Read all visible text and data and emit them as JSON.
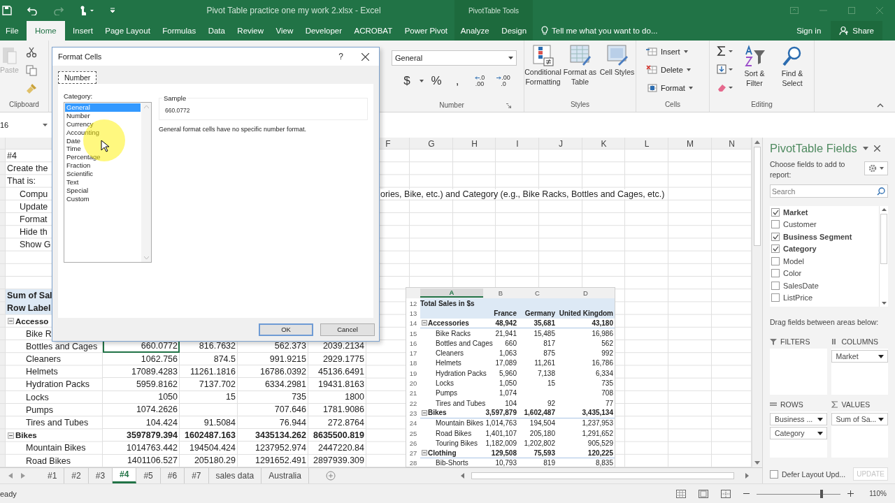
{
  "window": {
    "title": "Pivot Table practice one my work 2.xlsx - Excel",
    "context_group": "PivotTable Tools"
  },
  "ribbon_tabs": [
    {
      "label": "File",
      "selected": false,
      "contextual": false
    },
    {
      "label": "Home",
      "selected": true,
      "contextual": false
    },
    {
      "label": "Insert",
      "selected": false,
      "contextual": false
    },
    {
      "label": "Page Layout",
      "selected": false,
      "contextual": false
    },
    {
      "label": "Formulas",
      "selected": false,
      "contextual": false
    },
    {
      "label": "Data",
      "selected": false,
      "contextual": false
    },
    {
      "label": "Review",
      "selected": false,
      "contextual": false
    },
    {
      "label": "View",
      "selected": false,
      "contextual": false
    },
    {
      "label": "Developer",
      "selected": false,
      "contextual": false
    },
    {
      "label": "ACROBAT",
      "selected": false,
      "contextual": false
    },
    {
      "label": "Power Pivot",
      "selected": false,
      "contextual": false
    },
    {
      "label": "Analyze",
      "selected": false,
      "contextual": true
    },
    {
      "label": "Design",
      "selected": false,
      "contextual": true
    }
  ],
  "tell_me": "Tell me what you want to do...",
  "sign_in": "Sign in",
  "share": "Share",
  "ribbon": {
    "clipboard": {
      "paste": {
        "label": "Paste",
        "disabled": true
      },
      "label": "Clipboard"
    },
    "number": {
      "format": "General",
      "symbols": [
        "$",
        "%",
        ","
      ],
      "decimals": [
        {
          "top": ".0",
          "bottom": ".00"
        },
        {
          "top": ".00",
          "bottom": ".0"
        }
      ],
      "label": "Number"
    },
    "styles": {
      "buttons": [
        "Conditional Formatting",
        "Format as Table",
        "Cell Styles"
      ],
      "label": "Styles"
    },
    "cells": {
      "buttons": [
        "Insert",
        "Delete",
        "Format"
      ],
      "label": "Cells"
    },
    "editing": {
      "buttons": [
        "Sort & Filter",
        "Find & Select"
      ],
      "label": "Editing"
    }
  },
  "name_box": "16",
  "sheet": {
    "columns": [
      "F",
      "G",
      "H",
      "I",
      "J",
      "K",
      "L",
      "M",
      "N"
    ],
    "rows": [
      {
        "kind": "note",
        "text": "#4"
      },
      {
        "kind": "note",
        "text": "Create the"
      },
      {
        "kind": "note",
        "text": "That is:"
      },
      {
        "kind": "subnote",
        "text": "Compu",
        "continuation": "ories, Bike, etc.) and Category (e.g., Bike Racks, Bottles and Cages, etc.)"
      },
      {
        "kind": "subnote",
        "text": "Update"
      },
      {
        "kind": "subnote",
        "text": "Format"
      },
      {
        "kind": "subnote",
        "text": "Hide th"
      },
      {
        "kind": "subnote",
        "text": "Show G"
      },
      {
        "kind": "blank"
      },
      {
        "kind": "blank"
      },
      {
        "kind": "blank"
      },
      {
        "kind": "pivot_header",
        "text": "Sum of Sal"
      },
      {
        "kind": "pivot_header",
        "text": "Row Label"
      },
      {
        "kind": "group",
        "text": "Accesso",
        "expanded": true
      },
      {
        "kind": "item",
        "text": "Bike R"
      },
      {
        "kind": "item",
        "text": "Bottles and Cages",
        "values": [
          {
            "text": "660.0772",
            "selected": true
          },
          {
            "text": "816.7632",
            "selected": false
          },
          {
            "text": "562.373",
            "selected": false
          },
          {
            "text": "2039.2134",
            "selected": false
          }
        ]
      },
      {
        "kind": "item",
        "text": "Cleaners",
        "values": [
          {
            "text": "1062.756",
            "selected": false
          },
          {
            "text": "874.5",
            "selected": false
          },
          {
            "text": "991.9215",
            "selected": false
          },
          {
            "text": "2929.1775",
            "selected": false
          }
        ]
      },
      {
        "kind": "item",
        "text": "Helmets",
        "values": [
          {
            "text": "17089.4283",
            "selected": false
          },
          {
            "text": "11261.1816",
            "selected": false
          },
          {
            "text": "16786.0392",
            "selected": false
          },
          {
            "text": "45136.6491",
            "selected": false
          }
        ]
      },
      {
        "kind": "item",
        "text": "Hydration Packs",
        "values": [
          {
            "text": "5959.8162",
            "selected": false
          },
          {
            "text": "7137.702",
            "selected": false
          },
          {
            "text": "6334.2981",
            "selected": false
          },
          {
            "text": "19431.8163",
            "selected": false
          }
        ]
      },
      {
        "kind": "item",
        "text": "Locks",
        "values": [
          {
            "text": "1050",
            "selected": false
          },
          {
            "text": "15",
            "selected": false
          },
          {
            "text": "735",
            "selected": false
          },
          {
            "text": "1800",
            "selected": false
          }
        ]
      },
      {
        "kind": "item",
        "text": "Pumps",
        "values": [
          {
            "text": "1074.2626",
            "selected": false
          },
          {
            "selected": false
          },
          {
            "text": "707.646",
            "selected": false
          },
          {
            "text": "1781.9086",
            "selected": false
          }
        ]
      },
      {
        "kind": "item",
        "text": "Tires and Tubes",
        "values": [
          {
            "text": "104.424",
            "selected": false
          },
          {
            "text": "91.5084",
            "selected": false
          },
          {
            "text": "76.944",
            "selected": false
          },
          {
            "text": "272.8764",
            "selected": false
          }
        ]
      },
      {
        "kind": "group",
        "text": "Bikes",
        "expanded": true,
        "values": [
          {
            "text": "3597879.394",
            "selected": false
          },
          {
            "text": "1602487.163",
            "selected": false
          },
          {
            "text": "3435134.262",
            "selected": false
          },
          {
            "text": "8635500.819",
            "selected": false
          }
        ]
      },
      {
        "kind": "item",
        "text": "Mountain Bikes",
        "values": [
          {
            "text": "1014763.442",
            "selected": false
          },
          {
            "text": "194504.424",
            "selected": false
          },
          {
            "text": "1237952.974",
            "selected": false
          },
          {
            "text": "2447220.84",
            "selected": false
          }
        ]
      },
      {
        "kind": "item",
        "text": "Road Bikes",
        "values": [
          {
            "text": "1401106.527",
            "selected": false
          },
          {
            "text": "205180.29",
            "selected": false
          },
          {
            "text": "1291652.491",
            "selected": false
          },
          {
            "text": "2897939.309",
            "selected": false
          }
        ]
      }
    ]
  },
  "snapshot": {
    "columns": [
      {
        "label": "A",
        "selected": true
      },
      {
        "label": "B",
        "selected": false
      },
      {
        "label": "C",
        "selected": false
      },
      {
        "label": "D",
        "selected": false
      }
    ],
    "rows": [
      {
        "number": "12",
        "kind": "title",
        "label": "Total Sales in $s"
      },
      {
        "number": "13",
        "kind": "header",
        "france": "France",
        "germany": "Germany",
        "united_kingdom": "United Kingdom"
      },
      {
        "number": "14",
        "kind": "group",
        "label": "Accessories",
        "expanded": true,
        "france": "48,942",
        "germany": "35,681",
        "united_kingdom": "43,180"
      },
      {
        "number": "15",
        "kind": "item",
        "label": "Bike Racks",
        "france": "21,941",
        "germany": "15,485",
        "united_kingdom": "16,986"
      },
      {
        "number": "16",
        "kind": "item",
        "label": "Bottles and Cages",
        "france": "660",
        "germany": "817",
        "united_kingdom": "562"
      },
      {
        "number": "17",
        "kind": "item",
        "label": "Cleaners",
        "france": "1,063",
        "germany": "875",
        "united_kingdom": "992"
      },
      {
        "number": "18",
        "kind": "item",
        "label": "Helmets",
        "france": "17,089",
        "germany": "11,261",
        "united_kingdom": "16,786"
      },
      {
        "number": "19",
        "kind": "item",
        "label": "Hydration Packs",
        "france": "5,960",
        "germany": "7,138",
        "united_kingdom": "6,334"
      },
      {
        "number": "20",
        "kind": "item",
        "label": "Locks",
        "france": "1,050",
        "germany": "15",
        "united_kingdom": "735"
      },
      {
        "number": "21",
        "kind": "item",
        "label": "Pumps",
        "france": "1,074",
        "united_kingdom": "708"
      },
      {
        "number": "22",
        "kind": "item",
        "label": "Tires and Tubes",
        "france": "104",
        "germany": "92",
        "united_kingdom": "77"
      },
      {
        "number": "23",
        "kind": "group",
        "label": "Bikes",
        "expanded": true,
        "france": "3,597,879",
        "germany": "1,602,487",
        "united_kingdom": "3,435,134"
      },
      {
        "number": "24",
        "kind": "item",
        "label": "Mountain Bikes",
        "france": "1,014,763",
        "germany": "194,504",
        "united_kingdom": "1,237,953"
      },
      {
        "number": "25",
        "kind": "item",
        "label": "Road Bikes",
        "france": "1,401,107",
        "germany": "205,180",
        "united_kingdom": "1,291,652"
      },
      {
        "number": "26",
        "kind": "item",
        "label": "Touring Bikes",
        "france": "1,182,009",
        "germany": "1,202,802",
        "united_kingdom": "905,529"
      },
      {
        "number": "27",
        "kind": "group",
        "label": "Clothing",
        "expanded": true,
        "france": "129,508",
        "germany": "75,593",
        "united_kingdom": "120,225"
      },
      {
        "number": "28",
        "kind": "item",
        "label": "Bib-Shorts",
        "france": "10,793",
        "germany": "819",
        "united_kingdom": "8,835"
      }
    ]
  },
  "dialog": {
    "title": "Format Cells",
    "help": "?",
    "tabs": [
      {
        "label": "Number",
        "selected": true
      }
    ],
    "category_label": "Category:",
    "categories": [
      {
        "label": "General",
        "selected": true
      },
      {
        "label": "Number",
        "selected": false
      },
      {
        "label": "Currency",
        "selected": false
      },
      {
        "label": "Accounting",
        "selected": false
      },
      {
        "label": "Date",
        "selected": false
      },
      {
        "label": "Time",
        "selected": false
      },
      {
        "label": "Percentage",
        "selected": false
      },
      {
        "label": "Fraction",
        "selected": false
      },
      {
        "label": "Scientific",
        "selected": false
      },
      {
        "label": "Text",
        "selected": false
      },
      {
        "label": "Special",
        "selected": false
      },
      {
        "label": "Custom",
        "selected": false
      }
    ],
    "sample_label": "Sample",
    "sample_value": "660.0772",
    "description": "General format cells have no specific number format.",
    "buttons": [
      {
        "label": "OK",
        "kind": "default"
      },
      {
        "label": "Cancel",
        "kind": "normal"
      }
    ]
  },
  "pivot_fields": {
    "title": "PivotTable Fields",
    "subtitle": "Choose fields to add to report:",
    "search_placeholder": "Search",
    "fields": [
      {
        "name": "Market",
        "checked": true
      },
      {
        "name": "Customer",
        "checked": false
      },
      {
        "name": "Business Segment",
        "checked": true
      },
      {
        "name": "Category",
        "checked": true
      },
      {
        "name": "Model",
        "checked": false
      },
      {
        "name": "Color",
        "checked": false
      },
      {
        "name": "SalesDate",
        "checked": false
      },
      {
        "name": "ListPrice",
        "checked": false
      }
    ],
    "drag_hint": "Drag fields between areas below:",
    "areas": [
      {
        "kind": "filters",
        "title": "FILTERS"
      },
      {
        "kind": "columns",
        "title": "COLUMNS",
        "items": [
          "Market"
        ]
      },
      {
        "kind": "rows",
        "title": "ROWS",
        "items": [
          "Business ...",
          "Category"
        ]
      },
      {
        "kind": "values",
        "title": "VALUES",
        "items": [
          "Sum of Sa..."
        ]
      }
    ],
    "defer": {
      "label": "Defer Layout Upd...",
      "checked": false
    },
    "update_button": {
      "label": "UPDATE",
      "disabled": true
    }
  },
  "sheet_tabs": [
    {
      "label": "#1",
      "selected": false
    },
    {
      "label": "#2",
      "selected": false
    },
    {
      "label": "#3",
      "selected": false
    },
    {
      "label": "#4",
      "selected": true
    },
    {
      "label": "#5",
      "selected": false
    },
    {
      "label": "#6",
      "selected": false
    },
    {
      "label": "#7",
      "selected": false
    },
    {
      "label": "sales data",
      "selected": false
    },
    {
      "label": "Australia",
      "selected": false
    }
  ],
  "status": {
    "text": "eady",
    "zoom": {
      "label": "110%",
      "level": 0.77
    }
  }
}
